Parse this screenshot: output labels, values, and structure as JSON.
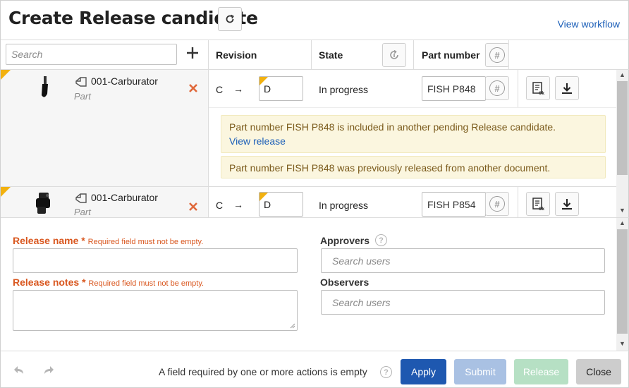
{
  "header": {
    "title": "Create Release candidate",
    "view_workflow": "View workflow"
  },
  "table": {
    "search_placeholder": "Search",
    "columns": {
      "revision": "Revision",
      "state": "State",
      "part_number": "Part number"
    },
    "rows": [
      {
        "part_name": "001-Carburator",
        "part_type": "Part",
        "rev_from": "C",
        "rev_arrow": "→",
        "rev_to": "D",
        "state": "In progress",
        "part_number": "FISH P848",
        "warnings": [
          {
            "text": "Part number FISH P848 is included in another pending Release candidate.",
            "link": "View release"
          },
          {
            "text": "Part number FISH P848 was previously released from another document."
          }
        ]
      },
      {
        "part_name": "001-Carburator",
        "part_type": "Part",
        "rev_from": "C",
        "rev_arrow": "→",
        "rev_to": "D",
        "state": "In progress",
        "part_number": "FISH P854"
      }
    ]
  },
  "form": {
    "release_name_label": "Release name",
    "release_notes_label": "Release notes",
    "required_star": "*",
    "required_note": "Required field must not be empty.",
    "approvers_label": "Approvers",
    "observers_label": "Observers",
    "search_users_placeholder": "Search users"
  },
  "footer": {
    "message": "A field required by one or more actions is empty",
    "apply": "Apply",
    "submit": "Submit",
    "release": "Release",
    "close": "Close"
  },
  "colors": {
    "accent": "#1e58b0",
    "required": "#d9571f",
    "warning_bg": "#fbf6df",
    "corner_flag": "#f2b10f"
  }
}
